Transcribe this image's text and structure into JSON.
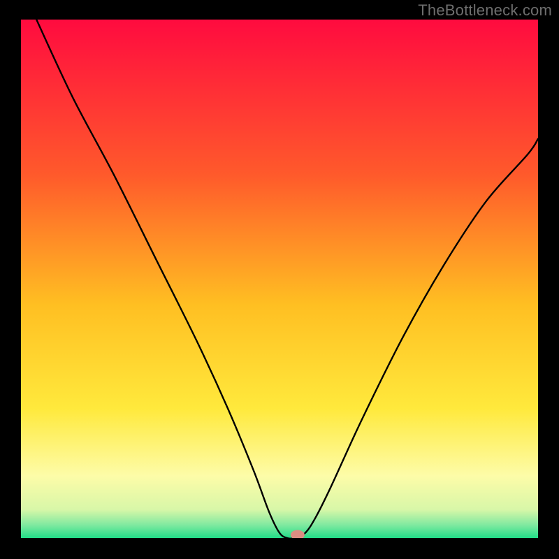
{
  "watermark": "TheBottleneck.com",
  "chart_data": {
    "type": "line",
    "title": "",
    "xlabel": "",
    "ylabel": "",
    "xlim": [
      0,
      100
    ],
    "ylim": [
      0,
      100
    ],
    "x": [
      3,
      10,
      18,
      26,
      34,
      40,
      45,
      48,
      50,
      51.5,
      53,
      55,
      57,
      60,
      66,
      74,
      82,
      90,
      98,
      100
    ],
    "values": [
      100,
      85,
      70,
      54,
      38,
      25,
      13,
      5,
      1,
      0,
      0,
      1,
      4,
      10,
      23,
      39,
      53,
      65,
      74,
      77
    ],
    "marker": {
      "x": 53.5,
      "y": 0.6
    },
    "gradient_stops": [
      {
        "offset": 0,
        "color": "#ff0b3f"
      },
      {
        "offset": 0.3,
        "color": "#ff5a2b"
      },
      {
        "offset": 0.55,
        "color": "#ffbf22"
      },
      {
        "offset": 0.75,
        "color": "#ffe93c"
      },
      {
        "offset": 0.88,
        "color": "#fdfca8"
      },
      {
        "offset": 0.945,
        "color": "#d8f7a8"
      },
      {
        "offset": 0.975,
        "color": "#7fe9a0"
      },
      {
        "offset": 1,
        "color": "#22dd88"
      }
    ]
  }
}
